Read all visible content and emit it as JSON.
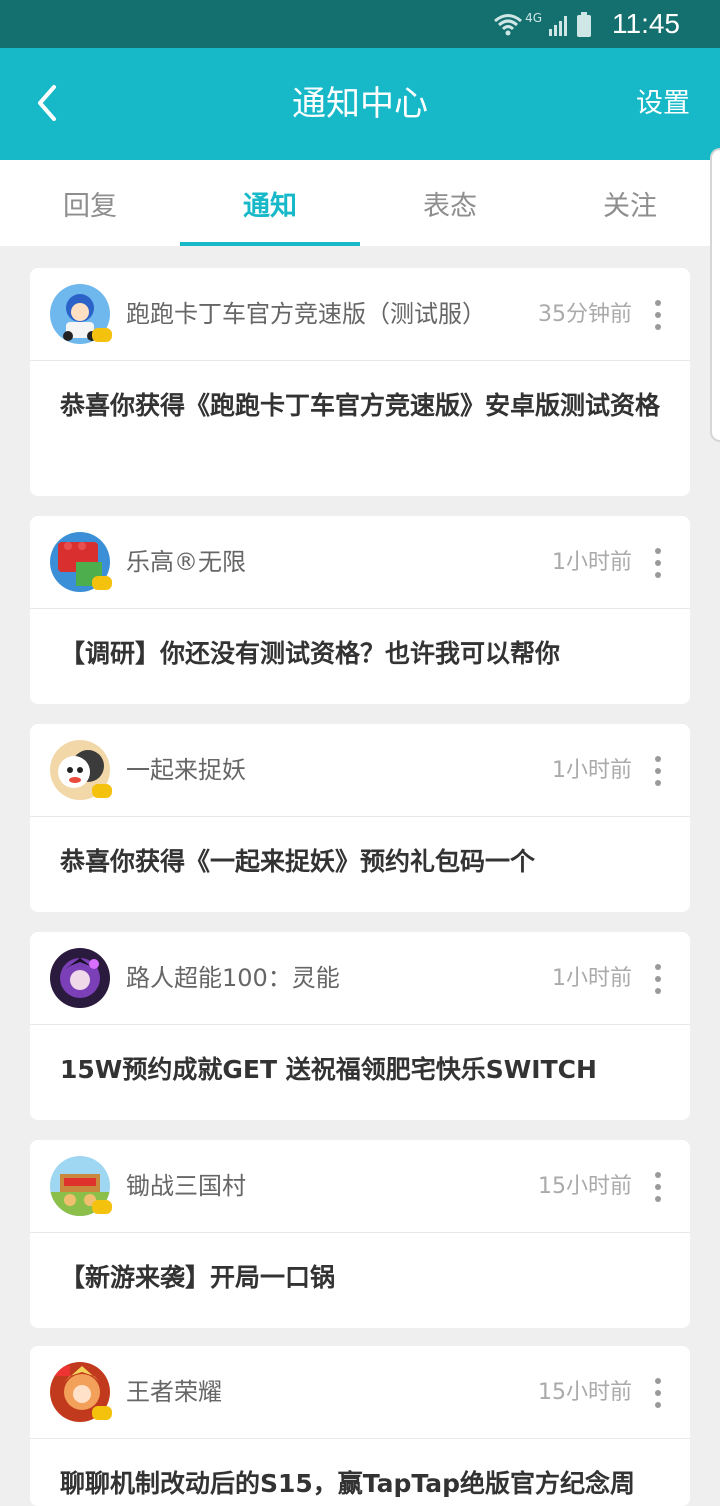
{
  "status_bar": {
    "network": "4G",
    "time": "11:45"
  },
  "app_bar": {
    "title": "通知中心",
    "settings_label": "设置",
    "back_icon": "chevron-left-icon"
  },
  "tabs": [
    {
      "label": "回复",
      "active": false
    },
    {
      "label": "通知",
      "active": true
    },
    {
      "label": "表态",
      "active": false
    },
    {
      "label": "关注",
      "active": false
    }
  ],
  "colors": {
    "accent": "#17b9c8",
    "status_bar": "#14706f",
    "background": "#efefef"
  },
  "notifications": [
    {
      "source": "跑跑卡丁车官方竞速版（测试服）",
      "time": "35分钟前",
      "message": "恭喜你获得《跑跑卡丁车官方竞速版》安卓版测试资格",
      "avatar_icon": "kart-game-icon"
    },
    {
      "source": "乐高®无限",
      "time": "1小时前",
      "message": "【调研】你还没有测试资格？也许我可以帮你",
      "avatar_icon": "lego-game-icon"
    },
    {
      "source": "一起来捉妖",
      "time": "1小时前",
      "message": "恭喜你获得《一起来捉妖》预约礼包码一个",
      "avatar_icon": "catch-monster-game-icon"
    },
    {
      "source": "路人超能100：灵能",
      "time": "1小时前",
      "message": "15W预约成就GET 送祝福领肥宅快乐SWITCH",
      "avatar_icon": "mob-psycho-game-icon"
    },
    {
      "source": "锄战三国村",
      "time": "15小时前",
      "message": "【新游来袭】开局一口锅",
      "avatar_icon": "three-kingdoms-village-game-icon"
    },
    {
      "source": "王者荣耀",
      "time": "15小时前",
      "message": "聊聊机制改动后的S15，赢TapTap绝版官方纪念周",
      "avatar_icon": "honor-of-kings-game-icon"
    }
  ]
}
